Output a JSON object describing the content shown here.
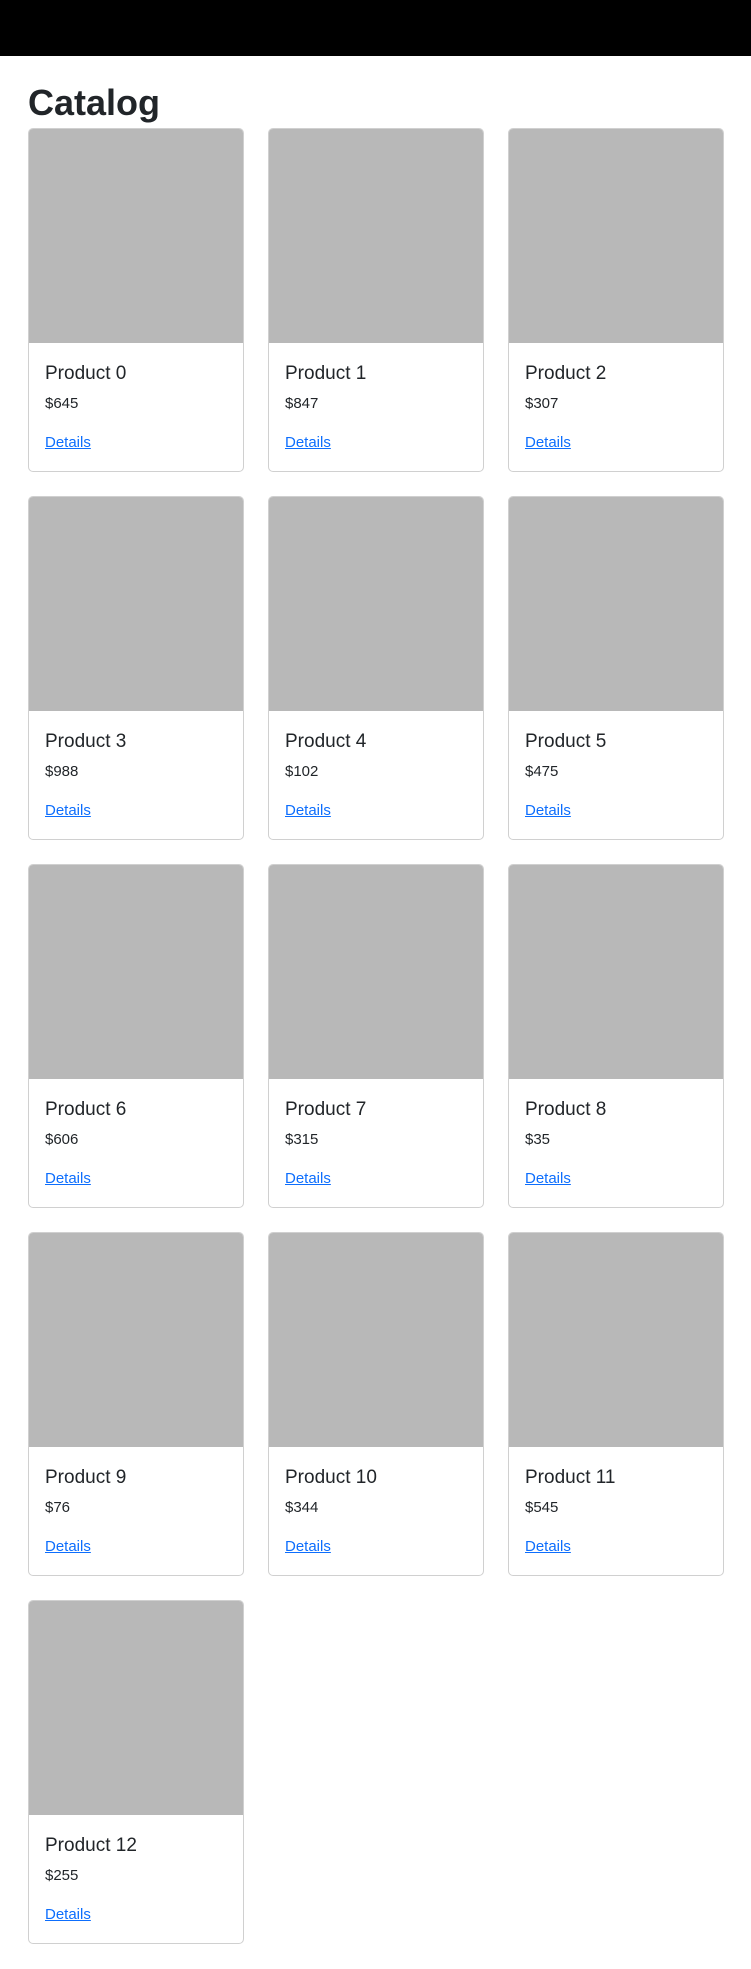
{
  "page": {
    "title": "Catalog"
  },
  "colors": {
    "topbar": "#000000",
    "placeholder_image": "#b8b8b8",
    "link": "#0d6efd",
    "card_border": "#d0d0d0"
  },
  "products": [
    {
      "name": "Product 0",
      "price": "$645",
      "link_label": "Details"
    },
    {
      "name": "Product 1",
      "price": "$847",
      "link_label": "Details"
    },
    {
      "name": "Product 2",
      "price": "$307",
      "link_label": "Details"
    },
    {
      "name": "Product 3",
      "price": "$988",
      "link_label": "Details"
    },
    {
      "name": "Product 4",
      "price": "$102",
      "link_label": "Details"
    },
    {
      "name": "Product 5",
      "price": "$475",
      "link_label": "Details"
    },
    {
      "name": "Product 6",
      "price": "$606",
      "link_label": "Details"
    },
    {
      "name": "Product 7",
      "price": "$315",
      "link_label": "Details"
    },
    {
      "name": "Product 8",
      "price": "$35",
      "link_label": "Details"
    },
    {
      "name": "Product 9",
      "price": "$76",
      "link_label": "Details"
    },
    {
      "name": "Product 10",
      "price": "$344",
      "link_label": "Details"
    },
    {
      "name": "Product 11",
      "price": "$545",
      "link_label": "Details"
    },
    {
      "name": "Product 12",
      "price": "$255",
      "link_label": "Details"
    }
  ]
}
